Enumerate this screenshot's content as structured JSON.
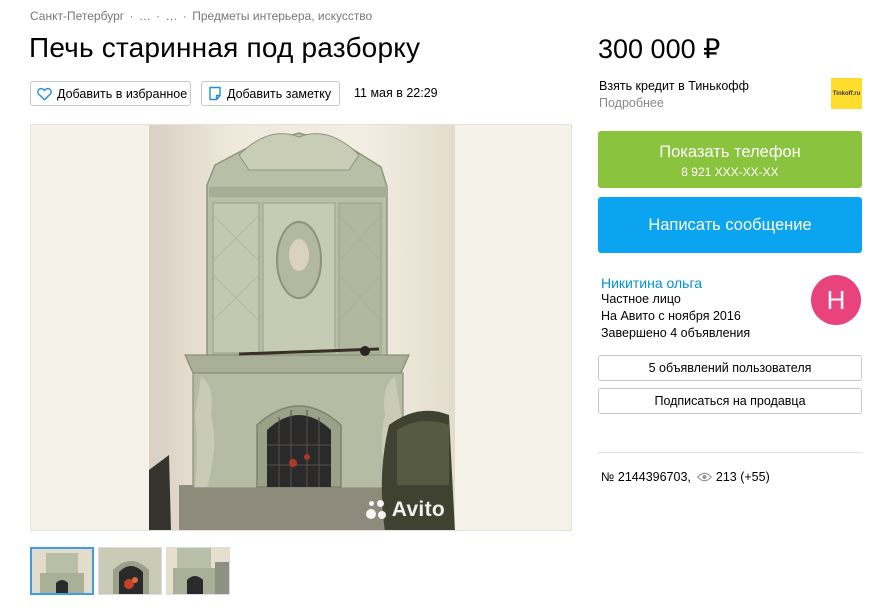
{
  "breadcrumb": {
    "items": [
      "Санкт-Петербург",
      "…",
      "…",
      "Предметы интерьера, искусство"
    ],
    "separator": "·"
  },
  "listing": {
    "title": "Печь старинная под разборку",
    "date": "11 мая в 22:29",
    "number": "№ 2144396703,",
    "views": "213 (+55)"
  },
  "actions": {
    "favorite_label": "Добавить в избранное",
    "note_label": "Добавить заметку"
  },
  "gallery": {
    "watermark": "Avito",
    "selected_thumb": 1,
    "thumb_count": 3
  },
  "sidebar": {
    "price": "300 000 ₽",
    "credit_label": "Взять кредит в Тинькофф",
    "credit_more": "Подробнее",
    "bank_logo_text": "Tinkoff.ru",
    "phone_button": "Показать телефон",
    "phone_masked": "8 921 XXX-XX-XX",
    "message_button": "Написать сообщение"
  },
  "seller": {
    "name": "Никитина ольга",
    "type": "Частное лицо",
    "since": "На Авито с ноября 2016",
    "completed": "Завершено 4 объявления",
    "avatar_letter": "Н",
    "ads_button": "5 объявлений пользователя",
    "subscribe_button": "Подписаться на продавца"
  },
  "colors": {
    "phone_button": "#8ac33d",
    "message_button": "#0aa4f0",
    "seller_link": "#0091d9",
    "avatar": "#e8447b",
    "bank_logo": "#ffdd2d",
    "thumb_selected": "#3d9ee6"
  },
  "icons": {
    "favorite": "heart-icon",
    "note": "note-icon",
    "views": "eye-icon",
    "watermark": "avito-logo-icon"
  }
}
